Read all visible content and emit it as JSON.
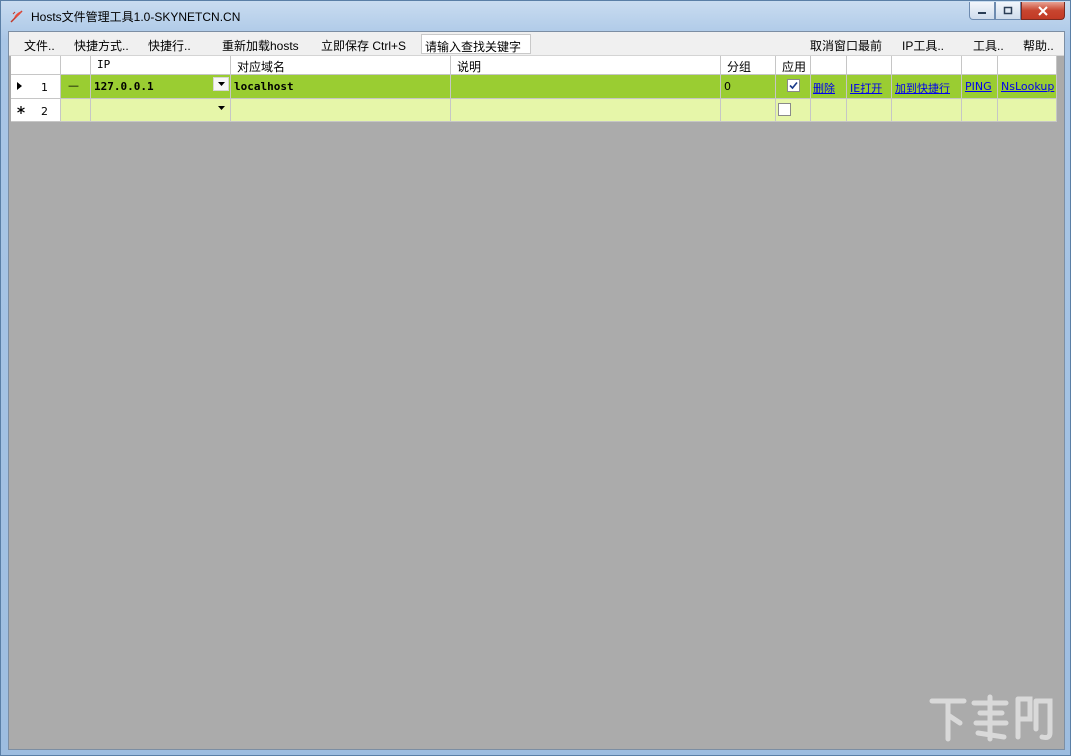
{
  "window": {
    "title": "Hosts文件管理工具1.0-SKYNETCN.CN"
  },
  "menu": {
    "file": "文件..",
    "shortcuts": "快捷方式..",
    "quick_run": "快捷行..",
    "reload": "重新加载hosts",
    "save": "立即保存 Ctrl+S",
    "search_placeholder": "请输入查找关键字",
    "cancel_topmost": "取消窗口最前",
    "ip_tools": "IP工具..",
    "tools": "工具..",
    "help": "帮助.."
  },
  "table": {
    "headers": {
      "ip": "IP",
      "domain": "对应域名",
      "desc": "说明",
      "group": "分组",
      "apply": "应用"
    },
    "rows": [
      {
        "num": "1",
        "marker": "—",
        "ip": "127.0.0.1",
        "domain": "localhost",
        "desc": "",
        "group": "0",
        "applied": true,
        "actions": {
          "delete": "删除",
          "ie_open": "IE打开",
          "add_quick": "加到快捷行",
          "ping": "PING",
          "nslookup": "NsLookup"
        }
      },
      {
        "num": "2",
        "marker": "",
        "ip": "",
        "domain": "",
        "desc": "",
        "group": "",
        "applied": false
      }
    ]
  },
  "icons": {
    "app": "app-feather-icon",
    "current_row": "row-pointer-icon",
    "new_row": "new-row-asterisk-icon"
  },
  "watermark": "下载吧"
}
